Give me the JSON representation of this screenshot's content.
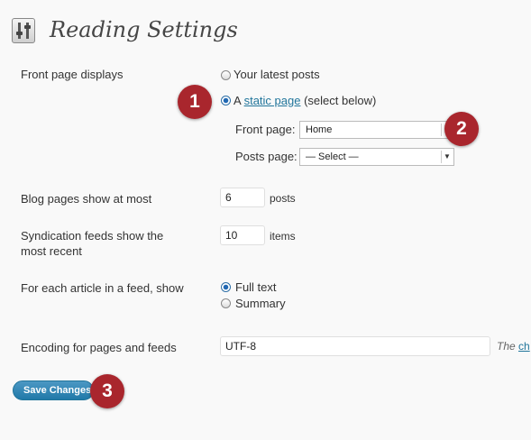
{
  "page": {
    "title": "Reading Settings"
  },
  "front_page_displays": {
    "label": "Front page displays",
    "option_latest": "Your latest posts",
    "option_static_prefix": "A",
    "option_static_link": "static page",
    "option_static_suffix": "(select below)",
    "front_page_label": "Front page:",
    "front_page_value": "Home",
    "posts_page_label": "Posts page:",
    "posts_page_value": "— Select —"
  },
  "blog_pages": {
    "label": "Blog pages show at most",
    "value": "6",
    "unit": "posts"
  },
  "syndication": {
    "label_line1": "Syndication feeds show the",
    "label_line2": "most recent",
    "value": "10",
    "unit": "items"
  },
  "feed_article": {
    "label": "For each article in a feed, show",
    "option_full": "Full text",
    "option_summary": "Summary"
  },
  "encoding": {
    "label": "Encoding for pages and feeds",
    "value": "UTF-8",
    "hint_prefix": "The",
    "hint_link": "ch"
  },
  "save_button": {
    "label": "Save Changes"
  },
  "badges": {
    "one": "1",
    "two": "2",
    "three": "3"
  },
  "colors": {
    "accent": "#21759b",
    "badge": "#a9262d",
    "button": "#2079a8"
  }
}
